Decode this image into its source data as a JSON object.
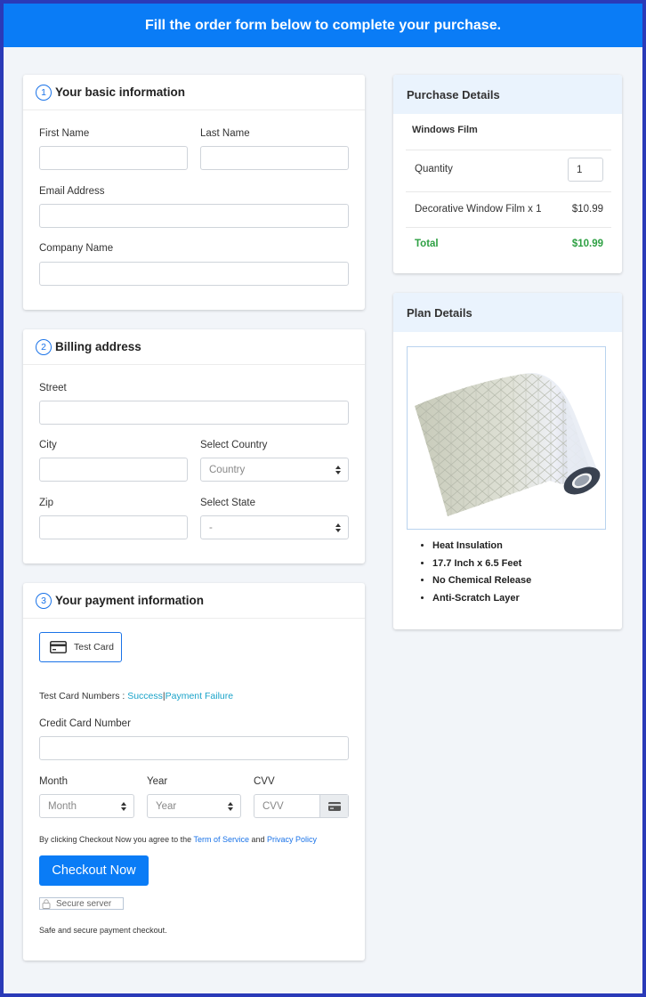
{
  "banner": {
    "text": "Fill the order form below to complete your purchase."
  },
  "basic_info": {
    "step": "1",
    "title": "Your basic information",
    "first_name_label": "First Name",
    "last_name_label": "Last Name",
    "email_label": "Email Address",
    "company_label": "Company Name"
  },
  "billing": {
    "step": "2",
    "title": "Billing address",
    "street_label": "Street",
    "city_label": "City",
    "country_label": "Select Country",
    "country_value": "Country",
    "zip_label": "Zip",
    "state_label": "Select State",
    "state_value": "-"
  },
  "payment": {
    "step": "3",
    "title": "Your payment information",
    "test_card_label": "Test Card",
    "test_numbers_label": "Test Card Numbers :",
    "success_link": "Success",
    "separator": "|",
    "failure_link": "Payment Failure",
    "cc_label": "Credit Card Number",
    "month_label": "Month",
    "month_value": "Month",
    "year_label": "Year",
    "year_value": "Year",
    "cvv_label": "CVV",
    "cvv_placeholder": "CVV",
    "terms_prefix": "By clicking Checkout Now you agree to the",
    "terms_link": "Term of Service",
    "terms_and": "and",
    "privacy_link": "Privacy Policy",
    "checkout_button": "Checkout Now",
    "secure_badge": "Secure server",
    "secure_note": "Safe and secure payment checkout."
  },
  "purchase": {
    "title": "Purchase Details",
    "product_name": "Windows Film",
    "quantity_label": "Quantity",
    "quantity_value": "1",
    "line_item": "Decorative Window Film x 1",
    "line_price": "$10.99",
    "total_label": "Total",
    "total_value": "$10.99"
  },
  "plan": {
    "title": "Plan Details",
    "features": [
      "Heat Insulation",
      "17.7 Inch x 6.5 Feet",
      "No Chemical Release",
      "Anti-Scratch Layer"
    ]
  },
  "colors": {
    "accent": "#0a7cf6",
    "total_green": "#2ea043",
    "link": "#1aa3c9",
    "background": "#2a3ab8"
  }
}
